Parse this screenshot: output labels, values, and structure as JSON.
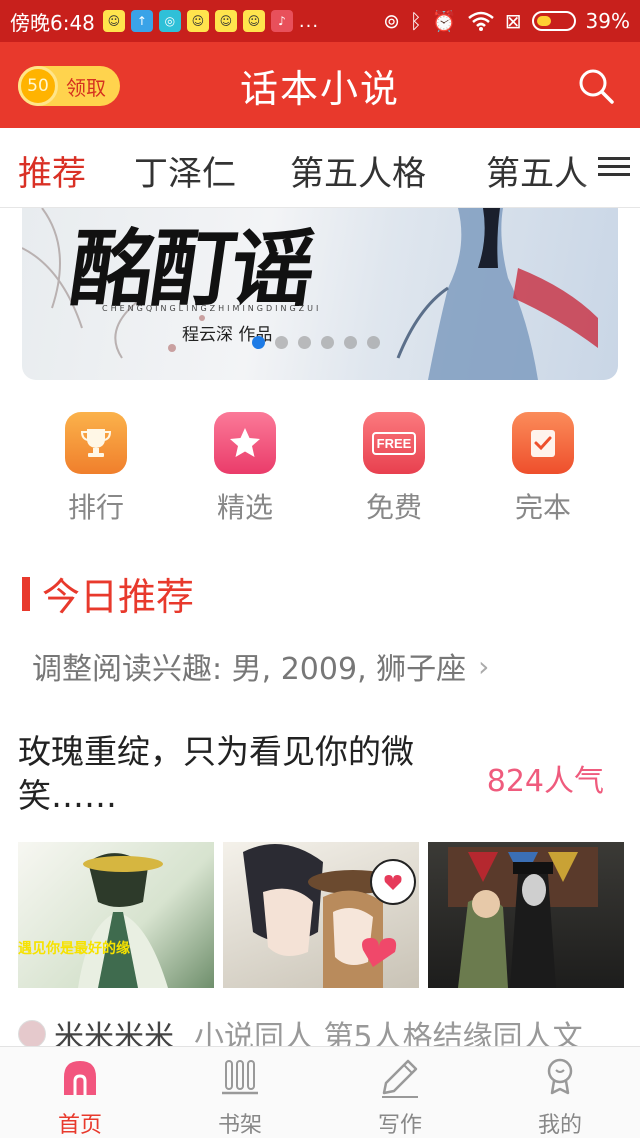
{
  "status_bar": {
    "time": "傍晚6:48",
    "dots": "...",
    "battery": "39%",
    "battery_level": 0.39
  },
  "header": {
    "coin_value": "50",
    "coin_label": "领取",
    "title": "话本小说"
  },
  "tabs": [
    {
      "label": "推荐",
      "active": true
    },
    {
      "label": "丁泽仁",
      "active": false
    },
    {
      "label": "第五人格",
      "active": false
    },
    {
      "label": "第五人",
      "active": false
    }
  ],
  "banner": {
    "calligraphy": "酩酊谣",
    "pinyin": "CHENGQINGLINGZHIMINGDINGZUI",
    "author": "程云深 作品",
    "slide_count": 6,
    "active_slide": 0
  },
  "quick_nav": [
    {
      "label": "排行",
      "icon": "trophy-icon",
      "color": "#f7923a"
    },
    {
      "label": "精选",
      "icon": "star-icon",
      "color": "#f2567c"
    },
    {
      "label": "免费",
      "icon": "free-icon",
      "color": "#f15a63",
      "icon_text": "FREE"
    },
    {
      "label": "完本",
      "icon": "check-book-icon",
      "color": "#f46a3e"
    }
  ],
  "section": {
    "title": "今日推荐",
    "interest": "调整阅读兴趣: 男, 2009, 狮子座",
    "chevron": "›"
  },
  "card": {
    "title": "玫瑰重绽，只为看见你的微笑……",
    "popularity": "824人气",
    "thumb_caption": "遇见你是最好的缘",
    "author": "米米米米",
    "tags": "小说同人   第5人格结缘同人文"
  },
  "bottom_nav": [
    {
      "label": "首页",
      "icon": "home-icon",
      "active": true
    },
    {
      "label": "书架",
      "icon": "bookshelf-icon",
      "active": false
    },
    {
      "label": "写作",
      "icon": "pen-icon",
      "active": false
    },
    {
      "label": "我的",
      "icon": "profile-icon",
      "active": false
    }
  ],
  "colors": {
    "accent": "#e8392c",
    "status_bar": "#c8201c",
    "popularity": "#ef5b7d"
  }
}
